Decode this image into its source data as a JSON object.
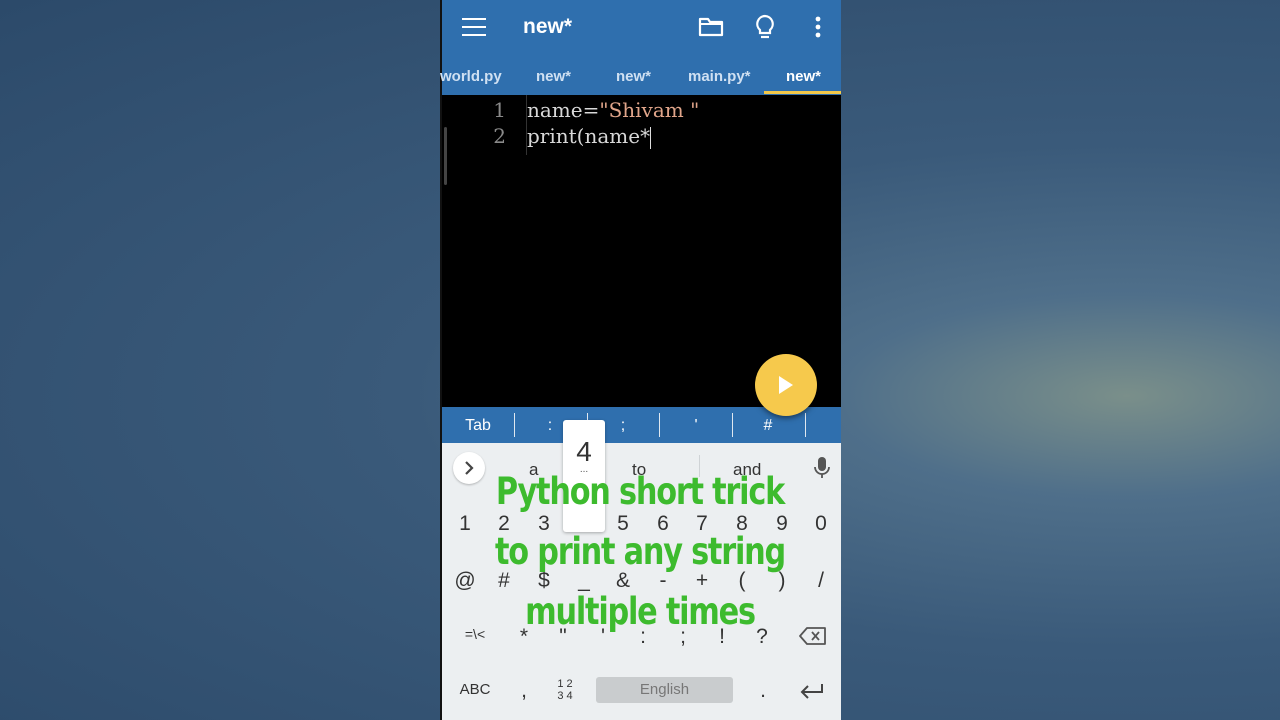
{
  "appbar": {
    "title": "new*",
    "icons": [
      "menu-icon",
      "folder-icon",
      "lightbulb-icon",
      "more-vert-icon"
    ]
  },
  "tabs": [
    {
      "label": "world.py",
      "active": false
    },
    {
      "label": "new*",
      "active": false
    },
    {
      "label": "new*",
      "active": false
    },
    {
      "label": "main.py*",
      "active": false
    },
    {
      "label": "new*",
      "active": true
    }
  ],
  "editor": {
    "lines": [
      {
        "num": "1",
        "pre": "name=",
        "str": "\"Shivam \"",
        "post": ""
      },
      {
        "num": "2",
        "pre": "print(name*",
        "str": "",
        "post": ""
      }
    ]
  },
  "symbols": [
    "Tab",
    ":",
    ";",
    "'",
    "#"
  ],
  "keyboard": {
    "suggestions": [
      "a",
      "to",
      "and"
    ],
    "popup_key": "4",
    "popup_more": "...",
    "numbers": [
      "1",
      "2",
      "3",
      "4",
      "5",
      "6",
      "7",
      "8",
      "9",
      "0"
    ],
    "row2": [
      "@",
      "#",
      "$",
      "_",
      "&",
      "-",
      "+",
      "(",
      ")",
      "/"
    ],
    "row3": [
      "=\\<",
      "*",
      "\"",
      "'",
      ":",
      ";",
      "!",
      "?"
    ],
    "abc": "ABC",
    "comma": ",",
    "numpad_top": "1 2",
    "numpad_bottom": "3 4",
    "space": "English",
    "period": "."
  },
  "overlay": {
    "line1": "Python short trick",
    "line2": "to print any string",
    "line3": "multiple times"
  },
  "colors": {
    "appbar": "#2f6fae",
    "accent": "#f3c84a",
    "fab": "#f6c94c",
    "overlay_text": "#3dbb2e"
  }
}
